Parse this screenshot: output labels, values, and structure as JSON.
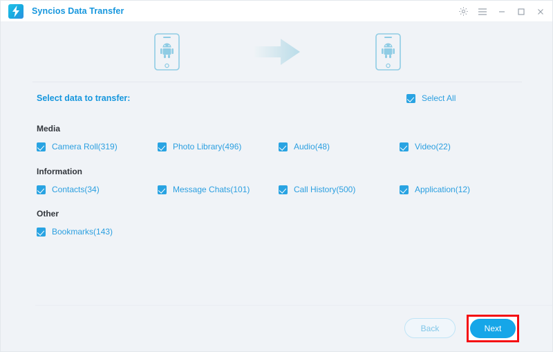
{
  "window": {
    "title": "Syncios Data Transfer",
    "logo_icon": "lightning-bolt-logo",
    "controls": [
      {
        "name": "settings",
        "icon": "gear-icon"
      },
      {
        "name": "menu",
        "icon": "hamburger-menu-icon"
      },
      {
        "name": "minimize",
        "icon": "minimize-icon"
      },
      {
        "name": "maximize",
        "icon": "maximize-icon"
      },
      {
        "name": "close",
        "icon": "close-icon"
      }
    ]
  },
  "devices": {
    "source_icon": "android-phone-icon",
    "arrow_icon": "right-arrow-icon",
    "target_icon": "android-phone-icon"
  },
  "select": {
    "label": "Select data to transfer:",
    "select_all_label": "Select All",
    "select_all_checked": true
  },
  "groups": [
    {
      "title": "Media",
      "items": [
        {
          "label": "Camera Roll(319)",
          "checked": true
        },
        {
          "label": "Photo Library(496)",
          "checked": true
        },
        {
          "label": "Audio(48)",
          "checked": true
        },
        {
          "label": "Video(22)",
          "checked": true
        }
      ]
    },
    {
      "title": "Information",
      "items": [
        {
          "label": "Contacts(34)",
          "checked": true
        },
        {
          "label": "Message Chats(101)",
          "checked": true
        },
        {
          "label": "Call History(500)",
          "checked": true
        },
        {
          "label": "Application(12)",
          "checked": true
        }
      ]
    },
    {
      "title": "Other",
      "items": [
        {
          "label": "Bookmarks(143)",
          "checked": true
        }
      ]
    }
  ],
  "footer": {
    "back_label": "Back",
    "next_label": "Next",
    "next_highlight_color": "#f40d12"
  },
  "colors": {
    "accent": "#16a6e8",
    "link": "#2b9fe0",
    "title": "#1596dd",
    "background": "#f0f3f7",
    "heading": "#31353b"
  }
}
